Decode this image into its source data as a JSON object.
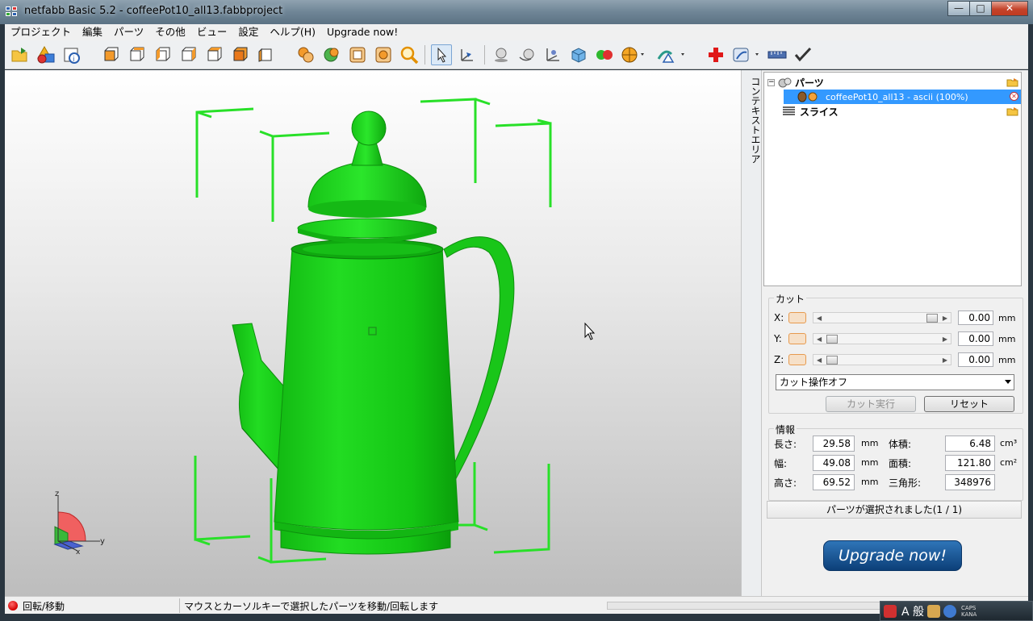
{
  "window": {
    "title": "netfabb Basic 5.2 - coffeePot10_all13.fabbproject",
    "minimize_label": "—",
    "maximize_label": "□",
    "close_label": "✕"
  },
  "menubar": {
    "items": [
      "プロジェクト",
      "編集",
      "パーツ",
      "その他",
      "ビュー",
      "設定",
      "ヘルプ(H)",
      "Upgrade now!"
    ]
  },
  "toolbar": {
    "icons": [
      "open-project-icon",
      "add-part-icon",
      "part-info-icon",
      "view-front-icon",
      "view-back-icon",
      "view-left-icon",
      "view-right-icon",
      "view-top-icon",
      "view-bottom-icon",
      "view-perspective-icon",
      "zoom-selected-icon",
      "zoom-all-icon",
      "zoom-frame-icon",
      "zoom-parts-icon",
      "zoom-magnifier-icon",
      "select-cursor-icon",
      "move-axes-icon",
      "sphere-view-icon",
      "rotate-view-icon",
      "coordinate-axes-icon",
      "cube-view-icon",
      "color-spheres-icon",
      "shading-mode-icon",
      "analysis-icon",
      "repair-cross-icon",
      "measure-icon",
      "ruler-icon",
      "check-icon"
    ],
    "selected": "select-cursor-icon"
  },
  "viewport": {
    "model_color": "#1fd91f",
    "axis_labels": {
      "x": "x",
      "y": "y",
      "z": "z"
    }
  },
  "context_area": {
    "tab_label": "コンテキストエリア",
    "tree": {
      "parts_label": "パーツ",
      "part_item_label": "coffeePot10_all13 - ascii (100%)",
      "slices_label": "スライス",
      "expander_symbol": "−"
    },
    "cut": {
      "title": "カット",
      "axes": [
        {
          "label": "X:",
          "value": "0.00",
          "unit": "mm",
          "position": 1.0
        },
        {
          "label": "Y:",
          "value": "0.00",
          "unit": "mm",
          "position": 0.0
        },
        {
          "label": "Z:",
          "value": "0.00",
          "unit": "mm",
          "position": 0.0
        }
      ],
      "mode_select": "カット操作オフ",
      "execute_button": "カット実行",
      "reset_button": "リセット"
    },
    "info": {
      "title": "情報",
      "length_label": "長さ:",
      "length_value": "29.58",
      "length_unit": "mm",
      "width_label": "幅:",
      "width_value": "49.08",
      "width_unit": "mm",
      "height_label": "高さ:",
      "height_value": "69.52",
      "height_unit": "mm",
      "volume_label": "体積:",
      "volume_value": "6.48",
      "volume_unit": "cm³",
      "area_label": "面積:",
      "area_value": "121.80",
      "area_unit": "cm²",
      "triangles_label": "三角形:",
      "triangles_value": "348976"
    },
    "selection_status": "パーツが選択されました(1 / 1)",
    "upgrade_button": "Upgrade now!"
  },
  "statusbar": {
    "mode": "回転/移動",
    "hint": "マウスとカーソルキーで選択したパーツを移動/回転します"
  },
  "ime": {
    "label": "A 般",
    "caps": "CAPS",
    "kana": "KANA"
  }
}
